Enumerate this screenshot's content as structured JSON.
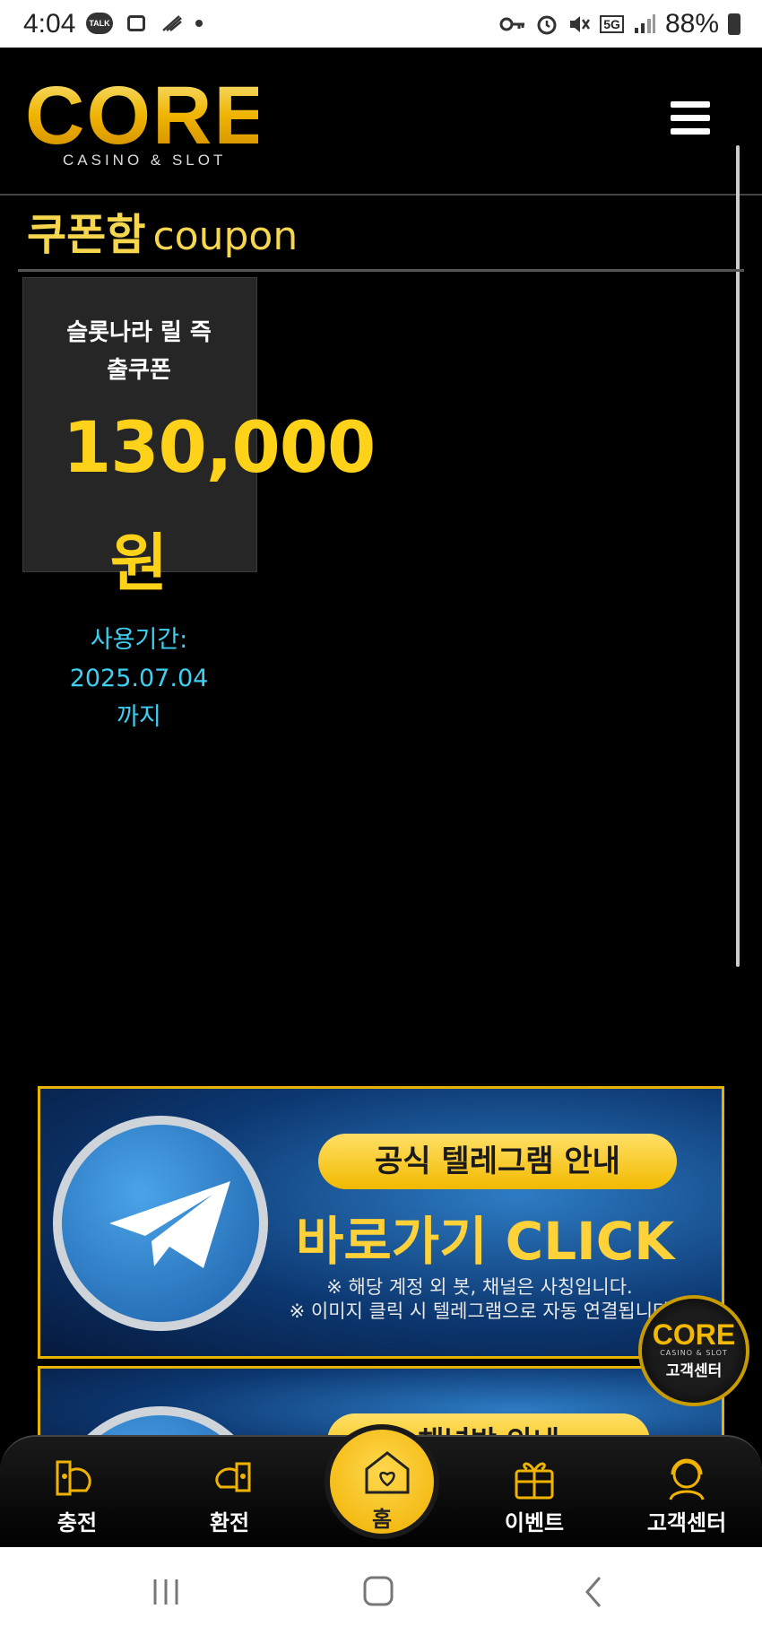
{
  "status_bar": {
    "time": "4:04",
    "notification_icons": [
      "talk-icon",
      "image-icon",
      "signal-slash-icon",
      "dot-icon"
    ],
    "talk_label": "TALK",
    "system_icons": [
      "key-icon",
      "alarm-icon",
      "mute-icon",
      "5g-icon",
      "signal-icon"
    ],
    "network": "5G",
    "battery": "88%"
  },
  "header": {
    "logo_text": "CORE",
    "logo_sub": "CASINO & SLOT",
    "menu_icon": "hamburger-icon"
  },
  "page": {
    "title": "쿠폰함",
    "title_en": "coupon"
  },
  "coupon": {
    "name": "슬롯나라 릴 즉출쿠폰",
    "name_line1": "슬롯나라 릴 즉",
    "name_line2": "출쿠폰",
    "amount": "130,000",
    "unit": "원",
    "period_label": "사용기간:",
    "period_date": "2025.07.04",
    "period_suffix": "까지"
  },
  "banners": [
    {
      "pill": "공식 텔레그램 안내",
      "main": "바로가기 CLICK",
      "note1": "※ 해당 계정 외 봇, 채널은 사칭입니다.",
      "note2": "※ 이미지 클릭 시 텔레그램으로 자동 연결됩니다"
    },
    {
      "pill": "채널방 안내"
    }
  ],
  "customer_center_float": {
    "logo": "CORE",
    "sub": "CASINO & SLOT",
    "label": "고객센터"
  },
  "bottom_nav": {
    "charge": "충전",
    "exchange": "환전",
    "home": "홈",
    "event": "이벤트",
    "support": "고객센터"
  },
  "colors": {
    "accent_gold": "#ffd21a",
    "period_cyan": "#3ecff2",
    "background": "#000000"
  }
}
